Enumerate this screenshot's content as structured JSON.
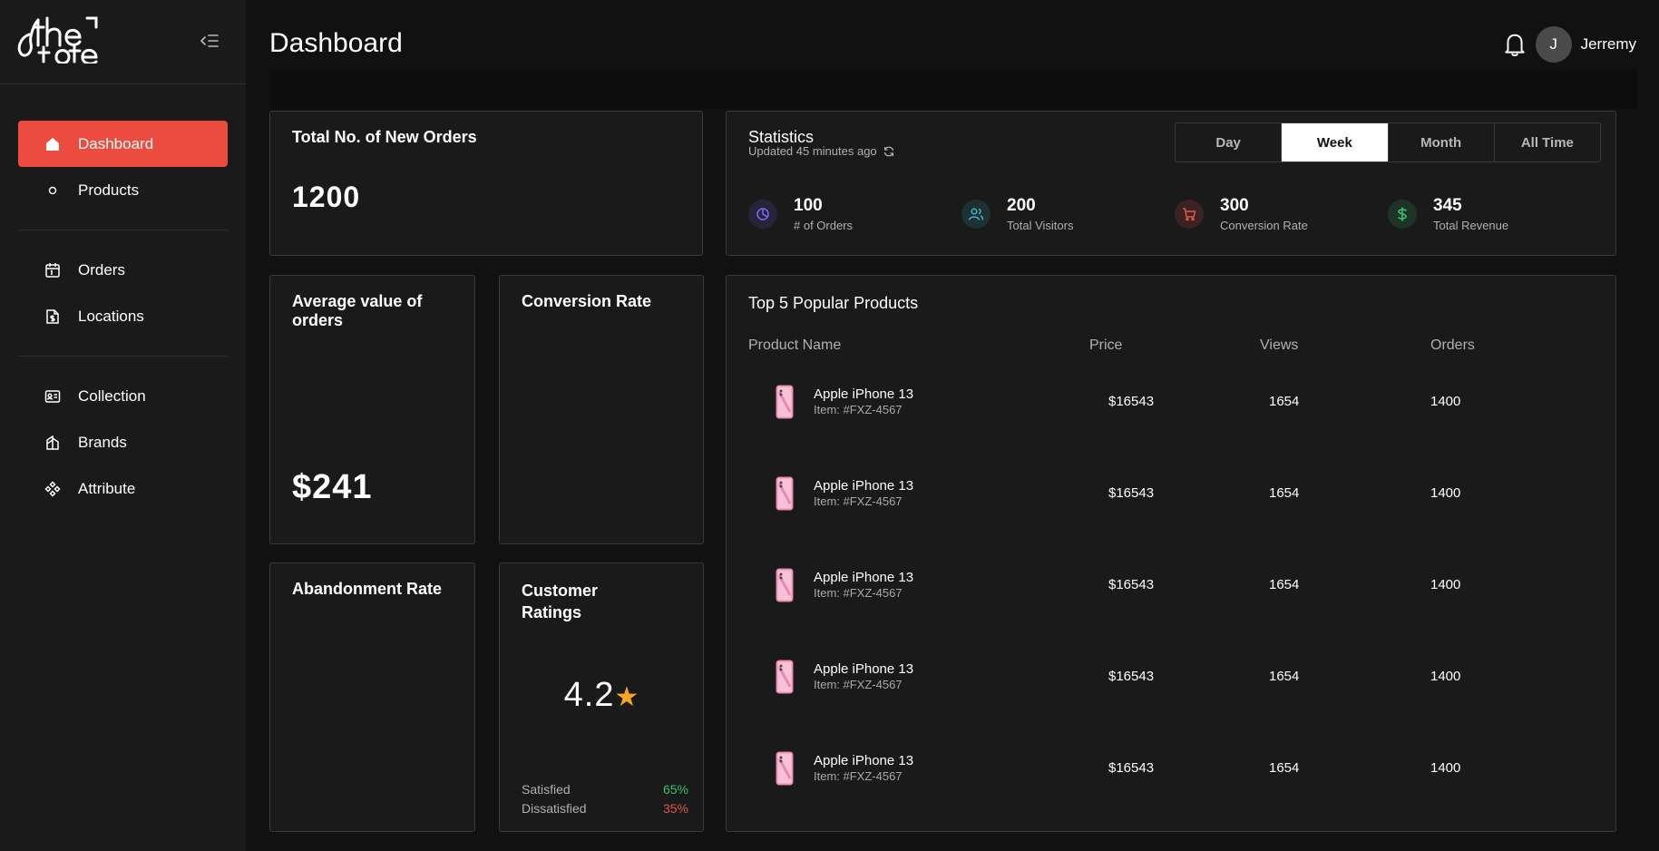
{
  "brand": {
    "logo_text": "thetote"
  },
  "sidebar": {
    "groups": [
      [
        {
          "label": "Dashboard",
          "icon": "home-icon",
          "active": true
        },
        {
          "label": "Products",
          "icon": "circle-icon",
          "active": false
        }
      ],
      [
        {
          "label": "Orders",
          "icon": "calendar-icon",
          "active": false
        },
        {
          "label": "Locations",
          "icon": "receipt-dollar-icon",
          "active": false
        }
      ],
      [
        {
          "label": "Collection",
          "icon": "id-card-icon",
          "active": false
        },
        {
          "label": "Brands",
          "icon": "tags-icon",
          "active": false
        },
        {
          "label": "Attribute",
          "icon": "diamond-grid-icon",
          "active": false
        }
      ]
    ]
  },
  "header": {
    "title": "Dashboard",
    "user": {
      "initial": "J",
      "name": "Jerremy"
    }
  },
  "cards": {
    "new_orders": {
      "title": "Total No. of New Orders",
      "value": "1200"
    },
    "avg_order": {
      "title": "Average value of orders",
      "value": "$241"
    },
    "conversion": {
      "title": "Conversion Rate"
    },
    "abandonment": {
      "title": "Abandonment Rate"
    },
    "ratings": {
      "title_line1": "Customer",
      "title_line2": "Ratings",
      "score": "4.2",
      "star": "★",
      "satisfied_label": "Satisfied",
      "satisfied_value": "65%",
      "dissatisfied_label": "Dissatisfied",
      "dissatisfied_value": "35%"
    }
  },
  "statistics": {
    "title": "Statistics",
    "updated": "Updated 45 minutes ago",
    "periods": [
      "Day",
      "Week",
      "Month",
      "All Time"
    ],
    "selected_period": "Week",
    "stats": [
      {
        "value": "100",
        "label": "# of Orders",
        "icon": "pie-chart-icon",
        "color": "#7b6cf6",
        "bg": "#26233a"
      },
      {
        "value": "200",
        "label": "Total Visitors",
        "icon": "users-icon",
        "color": "#3fb6c8",
        "bg": "#1d3033"
      },
      {
        "value": "300",
        "label": "Conversion Rate",
        "icon": "cart-icon",
        "color": "#e2554a",
        "bg": "#3a2322"
      },
      {
        "value": "345",
        "label": "Total Revenue",
        "icon": "dollar-icon",
        "color": "#3bbf6e",
        "bg": "#1d3326"
      }
    ]
  },
  "popular": {
    "title": "Top 5 Popular Products",
    "columns": [
      "Product Name",
      "Price",
      "Views",
      "Orders"
    ],
    "rows": [
      {
        "name": "Apple iPhone 13",
        "item": "Item: #FXZ-4567",
        "price": "$16543",
        "views": "1654",
        "orders": "1400"
      },
      {
        "name": "Apple iPhone 13",
        "item": "Item: #FXZ-4567",
        "price": "$16543",
        "views": "1654",
        "orders": "1400"
      },
      {
        "name": "Apple iPhone 13",
        "item": "Item: #FXZ-4567",
        "price": "$16543",
        "views": "1654",
        "orders": "1400"
      },
      {
        "name": "Apple iPhone 13",
        "item": "Item: #FXZ-4567",
        "price": "$16543",
        "views": "1654",
        "orders": "1400"
      },
      {
        "name": "Apple iPhone 13",
        "item": "Item: #FXZ-4567",
        "price": "$16543",
        "views": "1654",
        "orders": "1400"
      }
    ]
  },
  "colors": {
    "accent": "#ec4b3f",
    "star": "#f5a623",
    "positive": "#3bbf6e",
    "negative": "#e2554a"
  }
}
